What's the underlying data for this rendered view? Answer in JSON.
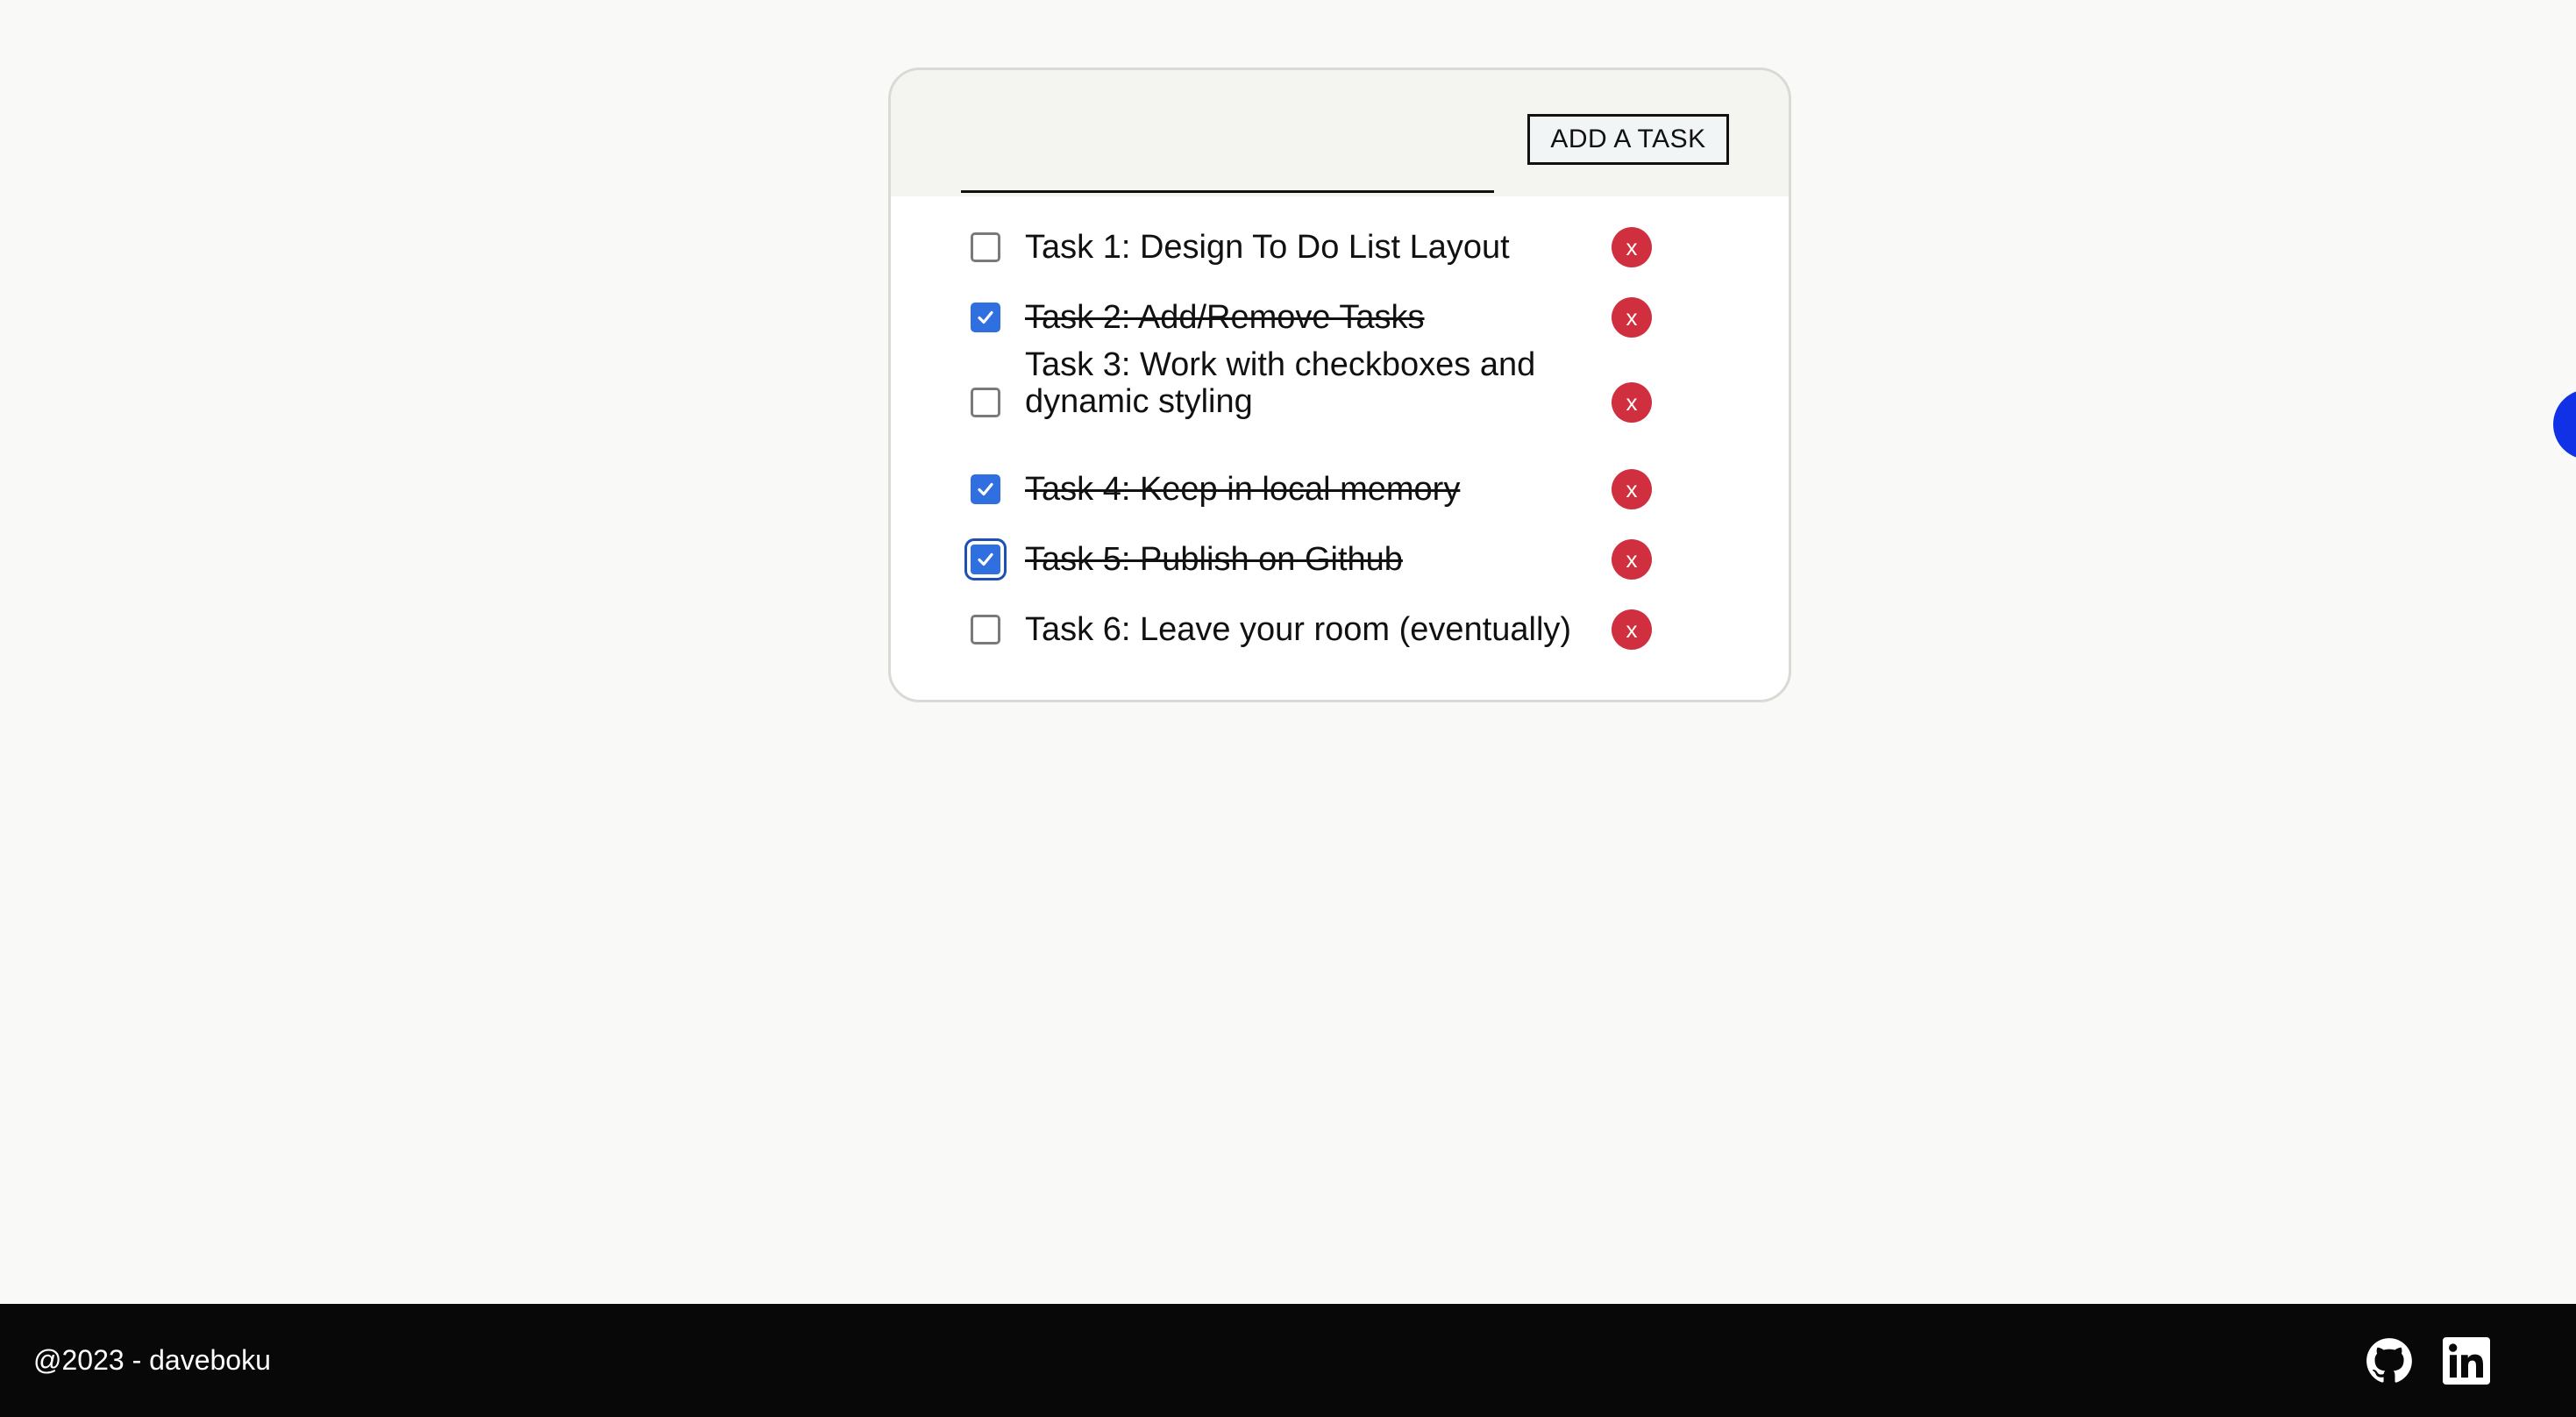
{
  "form": {
    "input_value": "",
    "add_button_label": "ADD A TASK"
  },
  "tasks": [
    {
      "label": "Task 1: Design To Do List Layout",
      "done": false,
      "remove_label": "x"
    },
    {
      "label": "Task 2: Add/Remove Tasks",
      "done": true,
      "remove_label": "x"
    },
    {
      "label": "Task 3: Work with checkboxes and dynamic styling",
      "done": false,
      "remove_label": "x"
    },
    {
      "label": "Task 4: Keep in local memory",
      "done": true,
      "remove_label": "x"
    },
    {
      "label": "Task 5: Publish on Github",
      "done": true,
      "remove_label": "x"
    },
    {
      "label": "Task 6: Leave your room (eventually)",
      "done": false,
      "remove_label": "x"
    }
  ],
  "footer": {
    "credit": "@2023 - daveboku",
    "icons": [
      "github-icon",
      "linkedin-icon"
    ]
  },
  "colors": {
    "page_bg": "#f9f9f7",
    "header_bg": "#f4f4f0",
    "checkbox_checked": "#2f6fe0",
    "remove_button": "#cf2f3e",
    "footer_bg": "#080808",
    "side_bubble": "#1131e6"
  }
}
